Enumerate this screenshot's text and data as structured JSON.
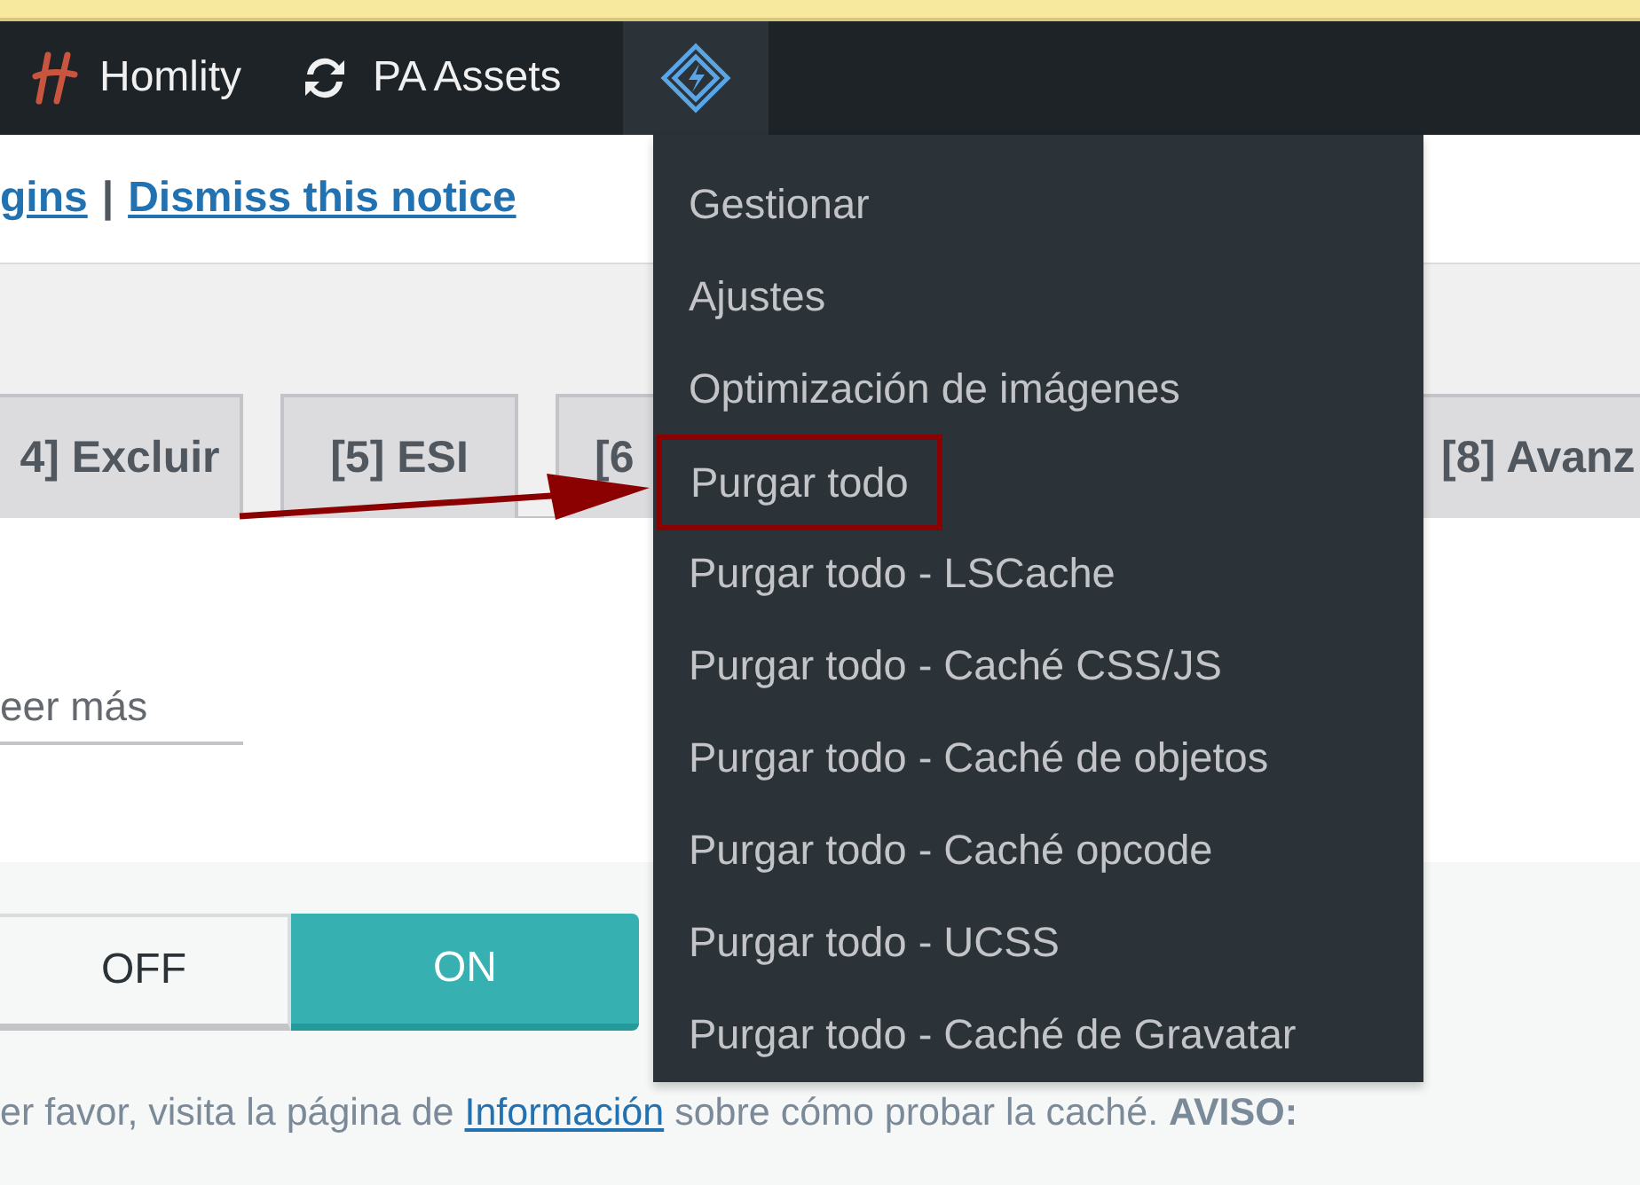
{
  "admin_bar": {
    "items": [
      {
        "kind": "logo",
        "label": "Homlity"
      },
      {
        "kind": "sync",
        "label": "PA Assets"
      },
      {
        "kind": "plugin",
        "selected": true
      }
    ]
  },
  "notice": {
    "links": [
      "gins",
      "Dismiss this notice"
    ],
    "separator": "|"
  },
  "tabs": [
    {
      "label": "4] Excluir",
      "selected": false
    },
    {
      "label": "[5] ESI",
      "selected": false
    },
    {
      "label": "[6",
      "selected": false
    },
    {
      "label": "[8] Avanz",
      "selected": false
    }
  ],
  "field": {
    "placeholder": "eer más"
  },
  "toggle": {
    "options": [
      {
        "label": "OFF",
        "selected": false
      },
      {
        "label": "ON",
        "selected": true
      }
    ]
  },
  "footer_text": {
    "before": "er favor, visita la página de ",
    "link": "Información",
    "after": " sobre cómo probar la caché. **AVISO:**"
  },
  "dropdown": {
    "items": [
      {
        "label": "Gestionar",
        "annotated": false
      },
      {
        "label": "Ajustes",
        "annotated": false
      },
      {
        "label": "Optimización de imágenes",
        "annotated": false
      },
      {
        "label": "Purgar todo",
        "annotated": true
      },
      {
        "label": "Purgar todo - LSCache",
        "annotated": false
      },
      {
        "label": "Purgar todo - Caché CSS/JS",
        "annotated": false
      },
      {
        "label": "Purgar todo - Caché de objetos",
        "annotated": false
      },
      {
        "label": "Purgar todo - Caché opcode",
        "annotated": false
      },
      {
        "label": "Purgar todo - UCSS",
        "annotated": false
      },
      {
        "label": "Purgar todo - Caché de Gravatar",
        "annotated": false
      }
    ]
  }
}
